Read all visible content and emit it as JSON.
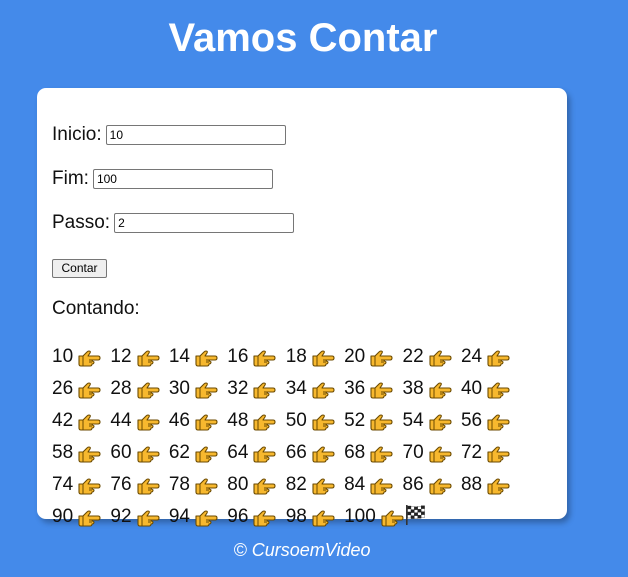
{
  "header": {
    "title": "Vamos Contar"
  },
  "form": {
    "inicio": {
      "label": "Inicio:",
      "value": "10"
    },
    "fim": {
      "label": "Fim:",
      "value": "100"
    },
    "passo": {
      "label": "Passo:",
      "value": "2"
    },
    "button_label": "Contar"
  },
  "result": {
    "heading": "Contando:",
    "values": [
      "10",
      "12",
      "14",
      "16",
      "18",
      "20",
      "22",
      "24",
      "26",
      "28",
      "30",
      "32",
      "34",
      "36",
      "38",
      "40",
      "42",
      "44",
      "46",
      "48",
      "50",
      "52",
      "54",
      "56",
      "58",
      "60",
      "62",
      "64",
      "66",
      "68",
      "70",
      "72",
      "74",
      "76",
      "78",
      "80",
      "82",
      "84",
      "86",
      "88",
      "90",
      "92",
      "94",
      "96",
      "98",
      "100"
    ],
    "separator_icon": "pointing-hand-icon",
    "end_icon": "checkered-flag-icon"
  },
  "footer": {
    "text": "© CursoemVideo"
  },
  "colors": {
    "background": "#448aea",
    "card": "#ffffff",
    "hand": "#f7b82e"
  }
}
